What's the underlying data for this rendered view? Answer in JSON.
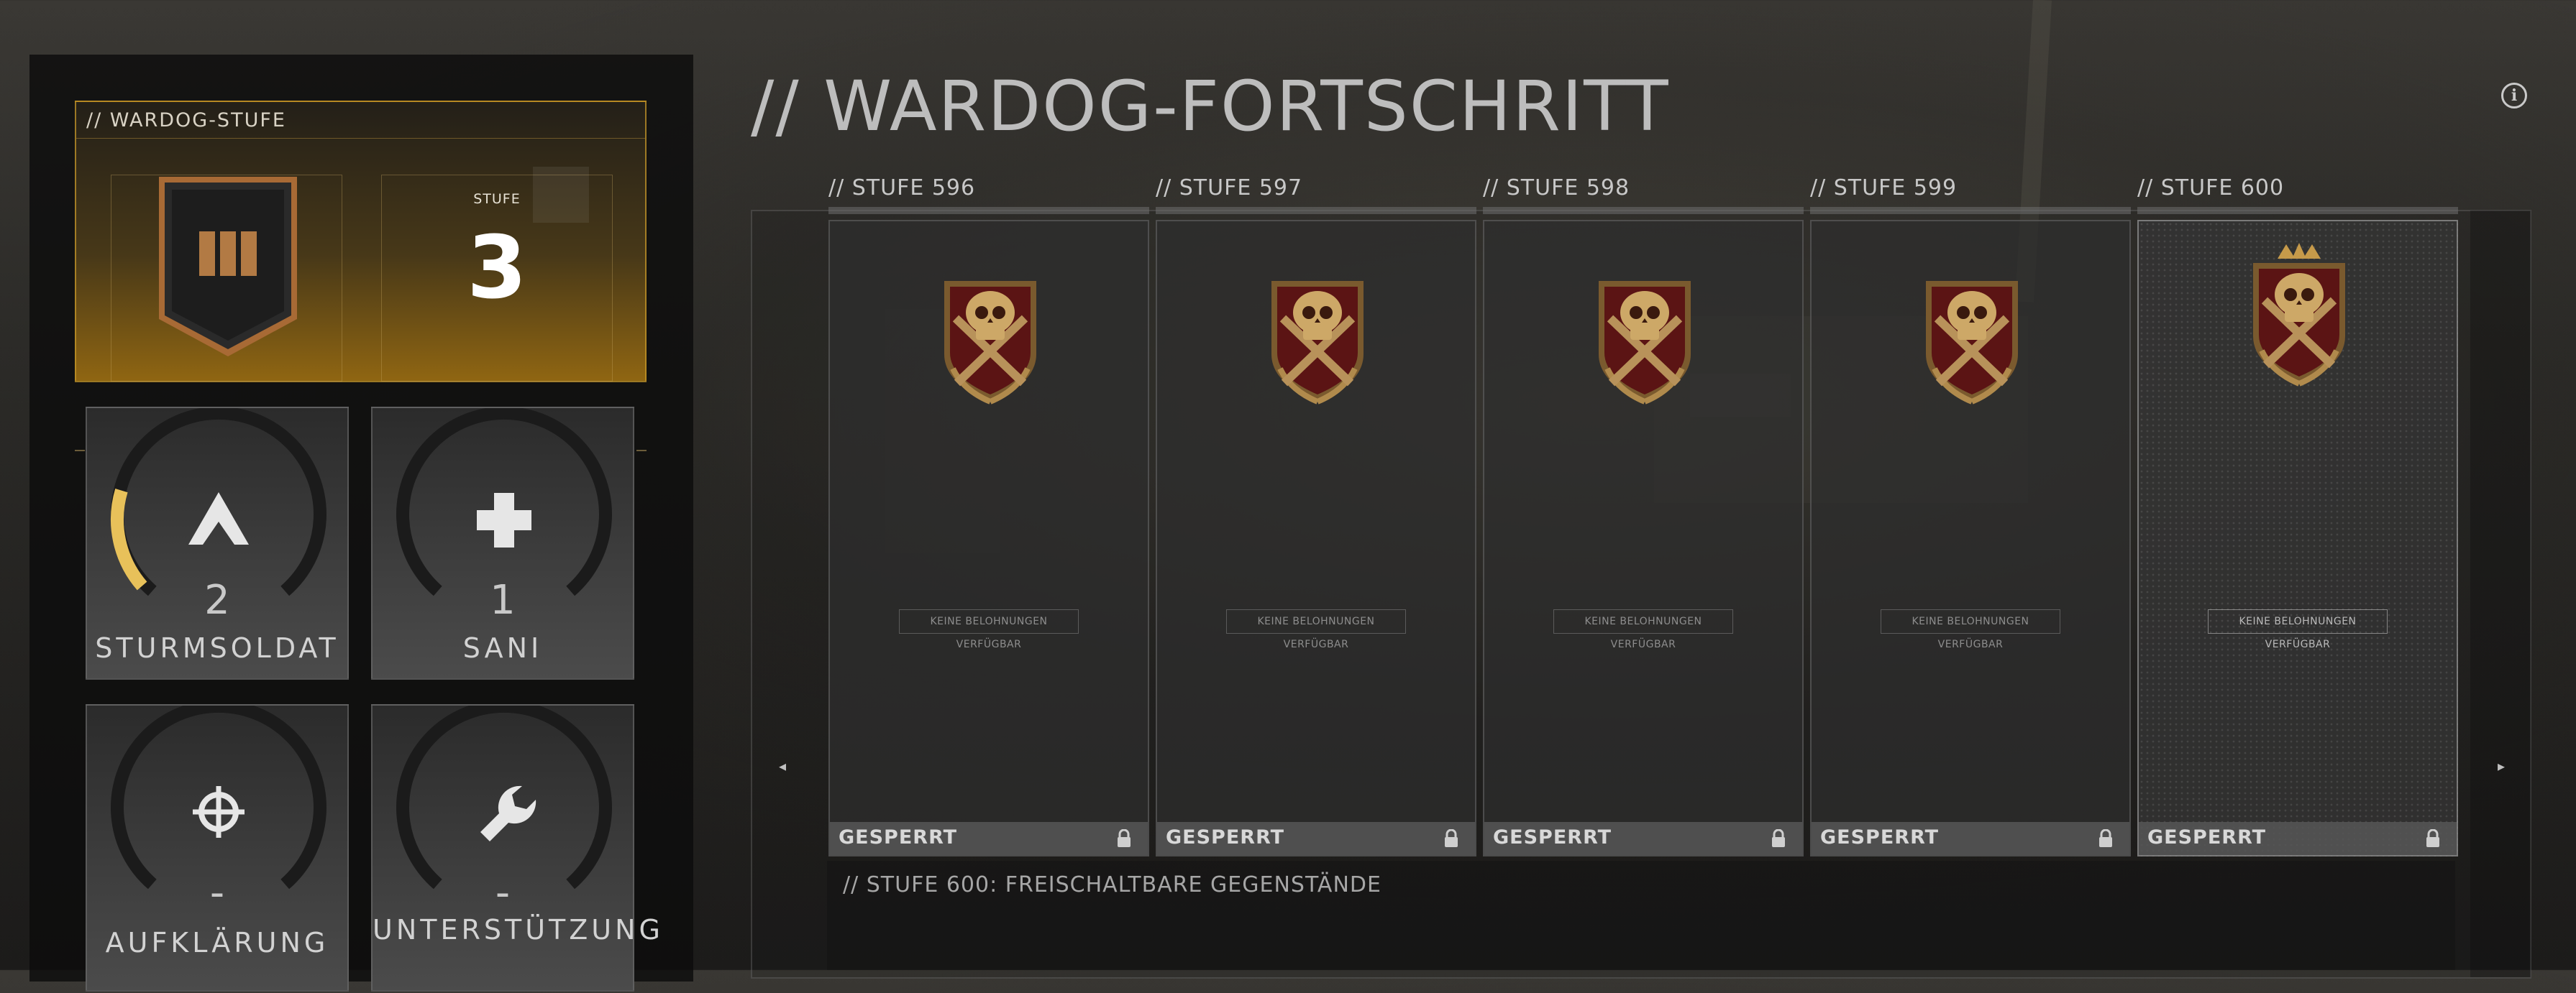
{
  "page": {
    "title": "// WARDOG-FORTSCHRITT",
    "info_icon": "info-icon"
  },
  "rank": {
    "title": "// WARDOG-STUFE",
    "stufe_label": "STUFE",
    "stufe_value": "3",
    "emblem_icon": "rank-chevron-emblem-icon"
  },
  "classes": [
    {
      "name": "STURMSOLDAT",
      "value": "2",
      "icon": "assault-chevron-icon",
      "progress_fraction": 0.22
    },
    {
      "name": "SANI",
      "value": "1",
      "icon": "medic-cross-icon",
      "progress_fraction": 0
    },
    {
      "name": "AUFKLÄRUNG",
      "value": "-",
      "icon": "crosshair-icon",
      "progress_fraction": 0
    },
    {
      "name": "UNTERSTÜTZUNG",
      "value": "-",
      "icon": "wrench-icon",
      "progress_fraction": 0
    }
  ],
  "tiers": [
    {
      "header": "// STUFE 596",
      "no_reward": "KEINE BELOHNUNGEN VERFÜGBAR",
      "status": "GESPERRT",
      "icon": "skull-crest-icon"
    },
    {
      "header": "// STUFE 597",
      "no_reward": "KEINE BELOHNUNGEN VERFÜGBAR",
      "status": "GESPERRT",
      "icon": "skull-crest-icon"
    },
    {
      "header": "// STUFE 598",
      "no_reward": "KEINE BELOHNUNGEN VERFÜGBAR",
      "status": "GESPERRT",
      "icon": "skull-crest-icon"
    },
    {
      "header": "// STUFE 599",
      "no_reward": "KEINE BELOHNUNGEN VERFÜGBAR",
      "status": "GESPERRT",
      "icon": "skull-crest-icon"
    },
    {
      "header": "// STUFE 600",
      "no_reward": "KEINE BELOHNUNGEN VERFÜGBAR",
      "status": "GESPERRT",
      "icon": "crowned-skull-crest-icon"
    }
  ],
  "unlocks": {
    "title": "// STUFE 600: FREISCHALTBARE GEGENSTÄNDE"
  },
  "nav": {
    "left": "◂",
    "right": "▸"
  },
  "colors": {
    "accent_gold": "#c4962a",
    "progress_yellow": "#e8c15a",
    "panel_dark": "#0c0c0c"
  }
}
